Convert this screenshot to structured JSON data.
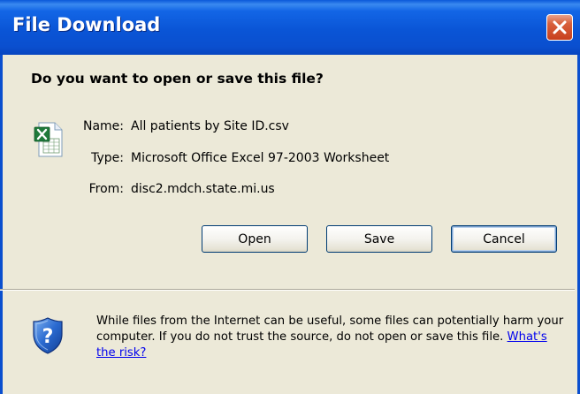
{
  "window": {
    "title": "File Download"
  },
  "dialog": {
    "question": "Do you want to open or save this file?",
    "file": {
      "icon": "excel-file-icon",
      "name_label": "Name:",
      "name": "All patients by Site ID.csv",
      "type_label": "Type:",
      "type": "Microsoft Office Excel 97-2003 Worksheet",
      "from_label": "From:",
      "from": "disc2.mdch.state.mi.us"
    },
    "buttons": {
      "open": "Open",
      "save": "Save",
      "cancel": "Cancel"
    },
    "warning": {
      "icon": "security-shield-question-icon",
      "text": "While files from the Internet can be useful, some files can potentially harm your computer. If you do not trust the source, do not open or save this file.",
      "link": "What's the risk?"
    }
  },
  "colors": {
    "titlebar": "#0a55d6",
    "dialog_bg": "#ece9d8",
    "close_button": "#d8603c",
    "link": "#0000ee"
  }
}
